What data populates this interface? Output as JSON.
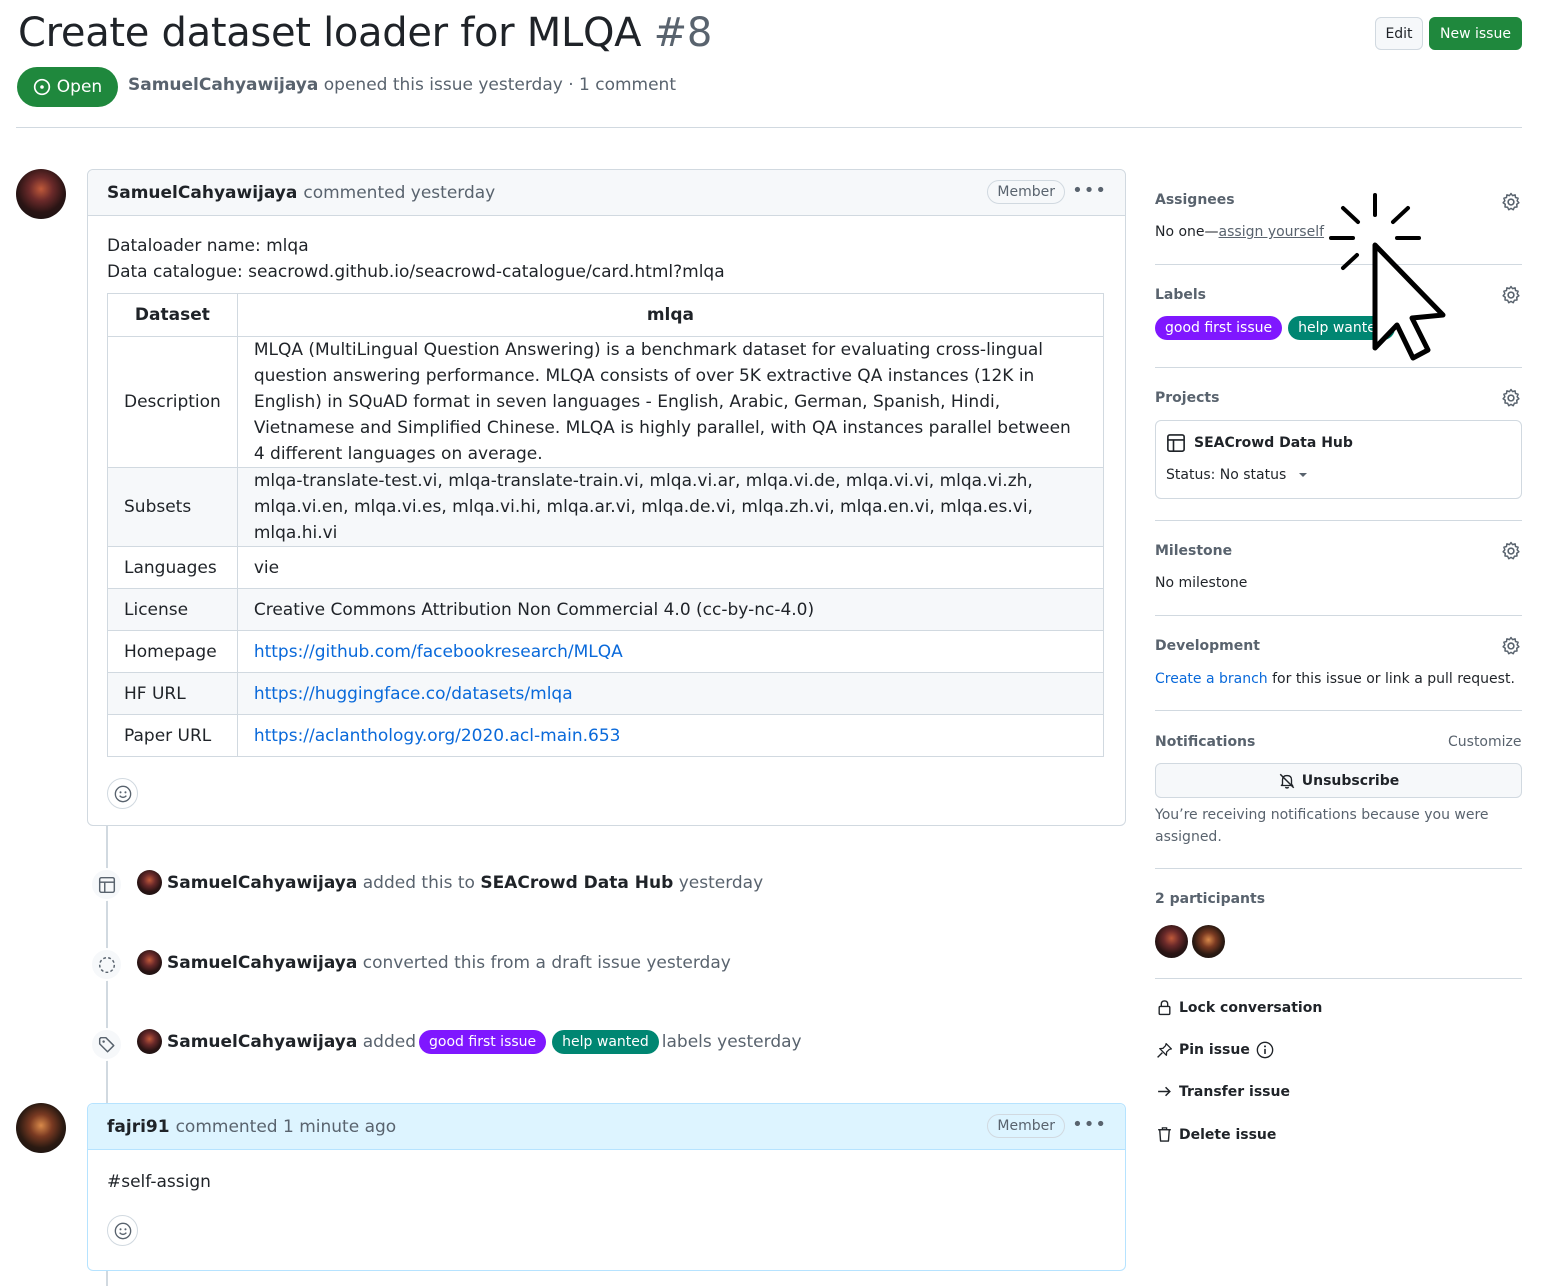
{
  "issue": {
    "title": "Create dataset loader for MLQA",
    "number": "#8",
    "state": "Open",
    "author": "SamuelCahyawijaya",
    "meta": "opened this issue yesterday · 1 comment",
    "edit_label": "Edit",
    "new_issue_label": "New issue"
  },
  "first_comment": {
    "author": "SamuelCahyawijaya",
    "action": "commented yesterday",
    "role": "Member",
    "line1": "Dataloader name: mlqa",
    "line2": "Data catalogue: seacrowd.github.io/seacrowd-catalogue/card.html?mlqa",
    "table": {
      "header_key": "Dataset",
      "header_val": "mlqa",
      "rows": [
        {
          "key": "Description",
          "value": "MLQA (MultiLingual Question Answering) is a benchmark dataset for evaluating cross-lingual question answering performance. MLQA consists of over 5K extractive QA instances (12K in English) in SQuAD format in seven languages - English, Arabic, German, Spanish, Hindi, Vietnamese and Simplified Chinese. MLQA is highly parallel, with QA instances parallel between 4 different languages on average."
        },
        {
          "key": "Subsets",
          "value": "mlqa-translate-test.vi, mlqa-translate-train.vi, mlqa.vi.ar, mlqa.vi.de, mlqa.vi.vi, mlqa.vi.zh, mlqa.vi.en, mlqa.vi.es, mlqa.vi.hi, mlqa.ar.vi, mlqa.de.vi, mlqa.zh.vi, mlqa.en.vi, mlqa.es.vi, mlqa.hi.vi"
        },
        {
          "key": "Languages",
          "value": "vie"
        },
        {
          "key": "License",
          "value": "Creative Commons Attribution Non Commercial 4.0 (cc-by-nc-4.0)"
        },
        {
          "key": "Homepage",
          "value": "https://github.com/facebookresearch/MLQA"
        },
        {
          "key": "HF URL",
          "value": "https://huggingface.co/datasets/mlqa"
        },
        {
          "key": "Paper URL",
          "value": "https://aclanthology.org/2020.acl-main.653"
        }
      ]
    }
  },
  "timeline": [
    {
      "icon": "table-icon",
      "actor": "SamuelCahyawijaya",
      "pre": "added this to",
      "bold": "SEACrowd Data Hub",
      "post": "yesterday"
    },
    {
      "icon": "dashed-circle-icon",
      "actor": "SamuelCahyawijaya",
      "pre": "converted this from a draft issue yesterday"
    },
    {
      "icon": "tag-icon",
      "actor": "SamuelCahyawijaya",
      "pre": "added",
      "post": "labels yesterday"
    }
  ],
  "labels": [
    {
      "name": "good first issue",
      "color": "#7f17ff"
    },
    {
      "name": "help wanted",
      "color": "#008672"
    }
  ],
  "second_comment": {
    "author": "fajri91",
    "action": "commented 1 minute ago",
    "role": "Member",
    "body": "#self-assign"
  },
  "sidebar": {
    "assignees": {
      "title": "Assignees",
      "text": "No one—",
      "link": "assign yourself"
    },
    "labels": {
      "title": "Labels"
    },
    "projects": {
      "title": "Projects",
      "name": "SEACrowd Data Hub",
      "status": "Status: No status"
    },
    "milestone": {
      "title": "Milestone",
      "text": "No milestone"
    },
    "development": {
      "title": "Development",
      "link": "Create a branch",
      "text": " for this issue or link a pull request."
    },
    "notifications": {
      "title": "Notifications",
      "customize": "Customize",
      "unsubscribe": "Unsubscribe",
      "reason": "You’re receiving notifications because you were assigned."
    },
    "participants": {
      "title": "2 participants"
    },
    "actions": {
      "lock": "Lock conversation",
      "pin": "Pin issue",
      "transfer": "Transfer issue",
      "delete": "Delete issue"
    }
  },
  "colors": {
    "green": "#1f883d",
    "link": "#0969da",
    "border": "#d1d9e0"
  }
}
